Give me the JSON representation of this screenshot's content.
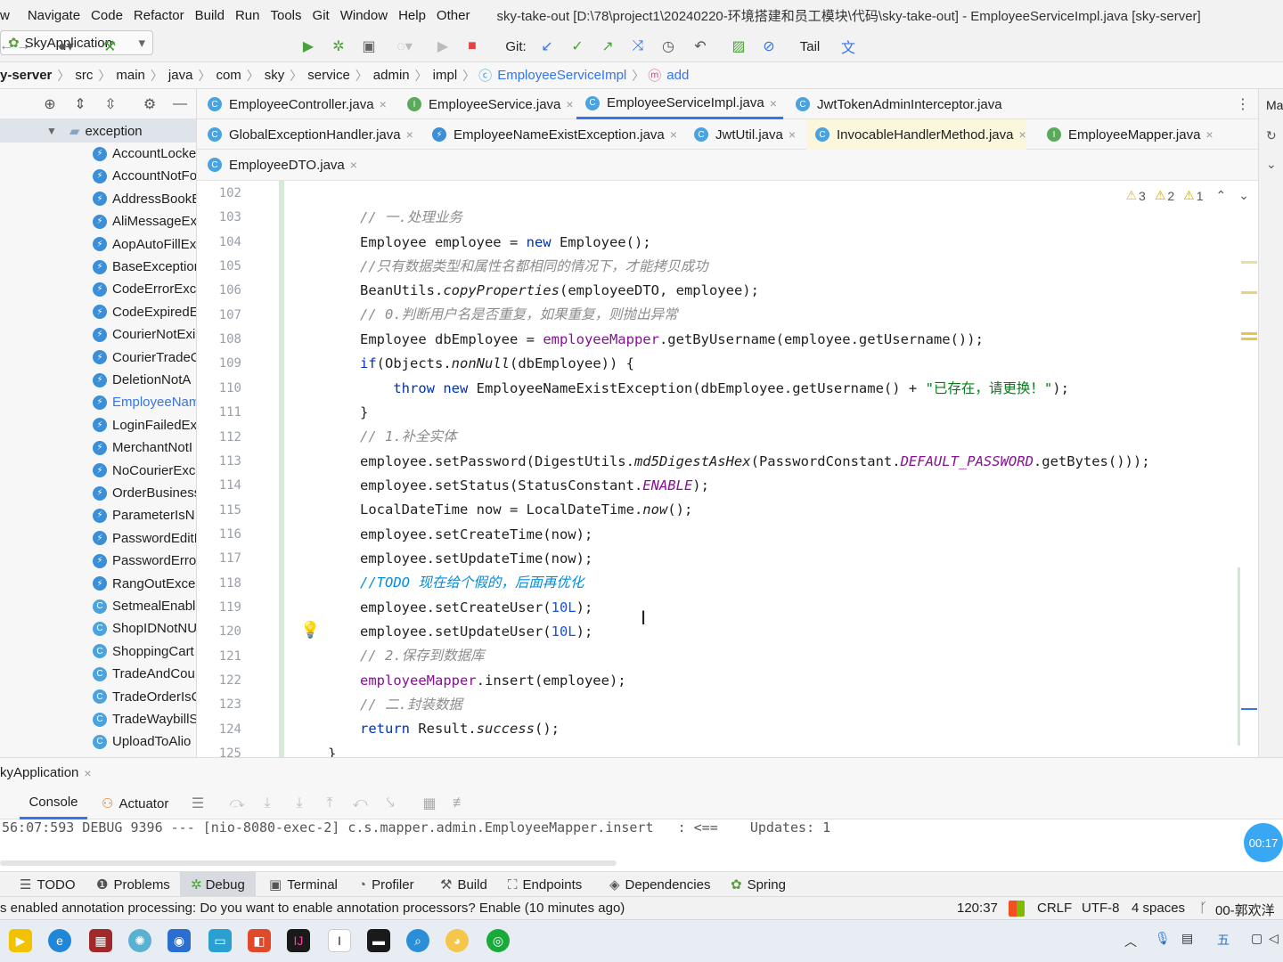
{
  "menu": {
    "items": [
      "w",
      "Navigate",
      "Code",
      "Refactor",
      "Build",
      "Run",
      "Tools",
      "Git",
      "Window",
      "Help",
      "Other"
    ],
    "window_title": "sky-take-out [D:\\78\\project1\\20240220-环境搭建和员工模块\\代码\\sky-take-out] - EmployeeServiceImpl.java [sky-server]"
  },
  "toolbar": {
    "run_config": "SkyApplication",
    "git_label": "Git:",
    "tail_label": "Tail"
  },
  "breadcrumb": [
    "y-server",
    "src",
    "main",
    "java",
    "com",
    "sky",
    "service",
    "admin",
    "impl",
    "EmployeeServiceImpl",
    "add"
  ],
  "project_tree": {
    "folder": "exception",
    "items": [
      {
        "label": "AccountLocke",
        "kind": "exception"
      },
      {
        "label": "AccountNotFo",
        "kind": "exception"
      },
      {
        "label": "AddressBookE",
        "kind": "exception"
      },
      {
        "label": "AliMessageEx",
        "kind": "exception"
      },
      {
        "label": "AopAutoFillEx",
        "kind": "exception"
      },
      {
        "label": "BaseException",
        "kind": "exception"
      },
      {
        "label": "CodeErrorExce",
        "kind": "exception"
      },
      {
        "label": "CodeExpiredE",
        "kind": "exception"
      },
      {
        "label": "CourierNotExi",
        "kind": "exception"
      },
      {
        "label": "CourierTradeC",
        "kind": "exception"
      },
      {
        "label": "DeletionNotA",
        "kind": "exception"
      },
      {
        "label": "EmployeeNam",
        "kind": "exception"
      },
      {
        "label": "LoginFailedEx",
        "kind": "exception"
      },
      {
        "label": "MerchantNotI",
        "kind": "exception"
      },
      {
        "label": "NoCourierExc",
        "kind": "exception"
      },
      {
        "label": "OrderBusiness",
        "kind": "exception"
      },
      {
        "label": "ParameterIsN",
        "kind": "exception"
      },
      {
        "label": "PasswordEditF",
        "kind": "exception"
      },
      {
        "label": "PasswordError",
        "kind": "exception"
      },
      {
        "label": "RangOutExcep",
        "kind": "exception"
      },
      {
        "label": "SetmealEnabl",
        "kind": "class"
      },
      {
        "label": "ShopIDNotNU",
        "kind": "class"
      },
      {
        "label": "ShoppingCart",
        "kind": "class"
      },
      {
        "label": "TradeAndCou",
        "kind": "class"
      },
      {
        "label": "TradeOrderIsC",
        "kind": "class"
      },
      {
        "label": "TradeWaybillS",
        "kind": "class"
      },
      {
        "label": "UploadToAlio",
        "kind": "class"
      }
    ]
  },
  "tabs": {
    "row1": [
      "EmployeeController.java",
      "EmployeeService.java",
      "EmployeeServiceImpl.java",
      "JwtTokenAdminInterceptor.java"
    ],
    "row2": [
      "GlobalExceptionHandler.java",
      "EmployeeNameExistException.java",
      "JwtUtil.java",
      "InvocableHandlerMethod.java",
      "EmployeeMapper.java"
    ],
    "row3": [
      "EmployeeDTO.java"
    ]
  },
  "inspections": {
    "warn_weak": "3",
    "warn": "2",
    "typo": "1"
  },
  "code": {
    "line_numbers": [
      "102",
      "103",
      "104",
      "105",
      "106",
      "107",
      "108",
      "109",
      "110",
      "111",
      "112",
      "113",
      "114",
      "115",
      "116",
      "117",
      "118",
      "119",
      "120",
      "121",
      "122",
      "123",
      "124",
      "125"
    ],
    "l103": "// 一.处理业务",
    "l105": "//只有数据类型和属性名都相同的情况下，才能拷贝成功",
    "l107": "// 0.判断用户名是否重复，如果重复，则抛出异常",
    "l110_str": "\"已存在，请更换！\"",
    "l112": "// 1.补全实体",
    "l118_todo": "//TODO 现在给个假的，后面再优化",
    "l121": "// 2.保存到数据库",
    "l123": "// 二.封装数据"
  },
  "run_panel": {
    "title": "kyApplication",
    "console_tab": "Console",
    "actuator_tab": "Actuator",
    "console_line": "56:07:593 DEBUG 9396 --- [nio-8080-exec-2] c.s.mapper.admin.EmployeeMapper.insert   : <==    Updates: 1"
  },
  "timer": "00:17",
  "tool_tabs": [
    "TODO",
    "Problems",
    "Debug",
    "Terminal",
    "Profiler",
    "Build",
    "Endpoints",
    "Dependencies",
    "Spring"
  ],
  "status_bar": {
    "message": "s enabled annotation processing: Do you want to enable annotation processors? Enable (10 minutes ago)",
    "position": "120:37",
    "line_sep": "CRLF",
    "encoding": "UTF-8",
    "indent": "4 spaces",
    "branch": "00-郭欢洋"
  },
  "right_strip": {
    "label": "Ma"
  }
}
